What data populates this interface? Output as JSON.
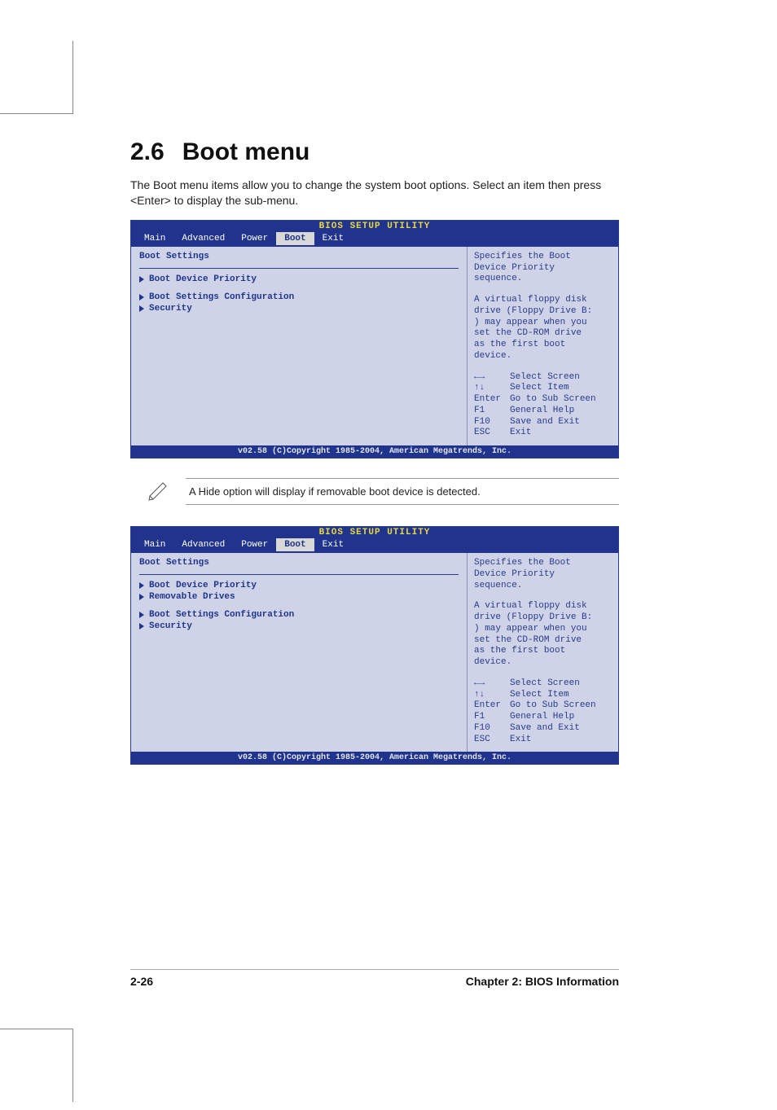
{
  "section": {
    "number": "2.6",
    "title": "Boot menu"
  },
  "intro": "The Boot menu items allow you to change the system boot options. Select an item then press <Enter> to display the sub-menu.",
  "bios_title": "BIOS SETUP UTILITY",
  "tabs": {
    "main": "Main",
    "advanced": "Advanced",
    "power": "Power",
    "boot": "Boot",
    "exit": "Exit"
  },
  "bios_footer": "v02.58 (C)Copyright 1985-2004, American Megatrends, Inc.",
  "help": {
    "line1": "Specifies the Boot",
    "line2": "Device Priority",
    "line3": "sequence.",
    "v1": "A virtual floppy disk",
    "v2": "drive (Floppy Drive B:",
    "v3": ") may appear when you",
    "v4": "set the CD-ROM drive",
    "v5": "as the first boot",
    "v6": "device."
  },
  "keys": {
    "lr": {
      "sym": "←→",
      "label": "Select Screen"
    },
    "ud": {
      "sym": "↑↓",
      "label": "Select Item"
    },
    "enter": {
      "sym": "Enter",
      "label": "Go to Sub Screen"
    },
    "f1": {
      "sym": "F1",
      "label": "General Help"
    },
    "f10": {
      "sym": "F10",
      "label": "Save and Exit"
    },
    "esc": {
      "sym": "ESC",
      "label": "Exit"
    }
  },
  "panel1": {
    "heading": "Boot Settings",
    "items": [
      "Boot Device Priority",
      "Boot Settings Configuration",
      "Security"
    ]
  },
  "panel2": {
    "heading": "Boot Settings",
    "items": [
      "Boot Device Priority",
      "Removable Drives",
      "Boot Settings Configuration",
      "Security"
    ]
  },
  "note": "A Hide option will display if removable boot device is detected.",
  "footer": {
    "left": "2-26",
    "right": "Chapter 2: BIOS Information"
  }
}
